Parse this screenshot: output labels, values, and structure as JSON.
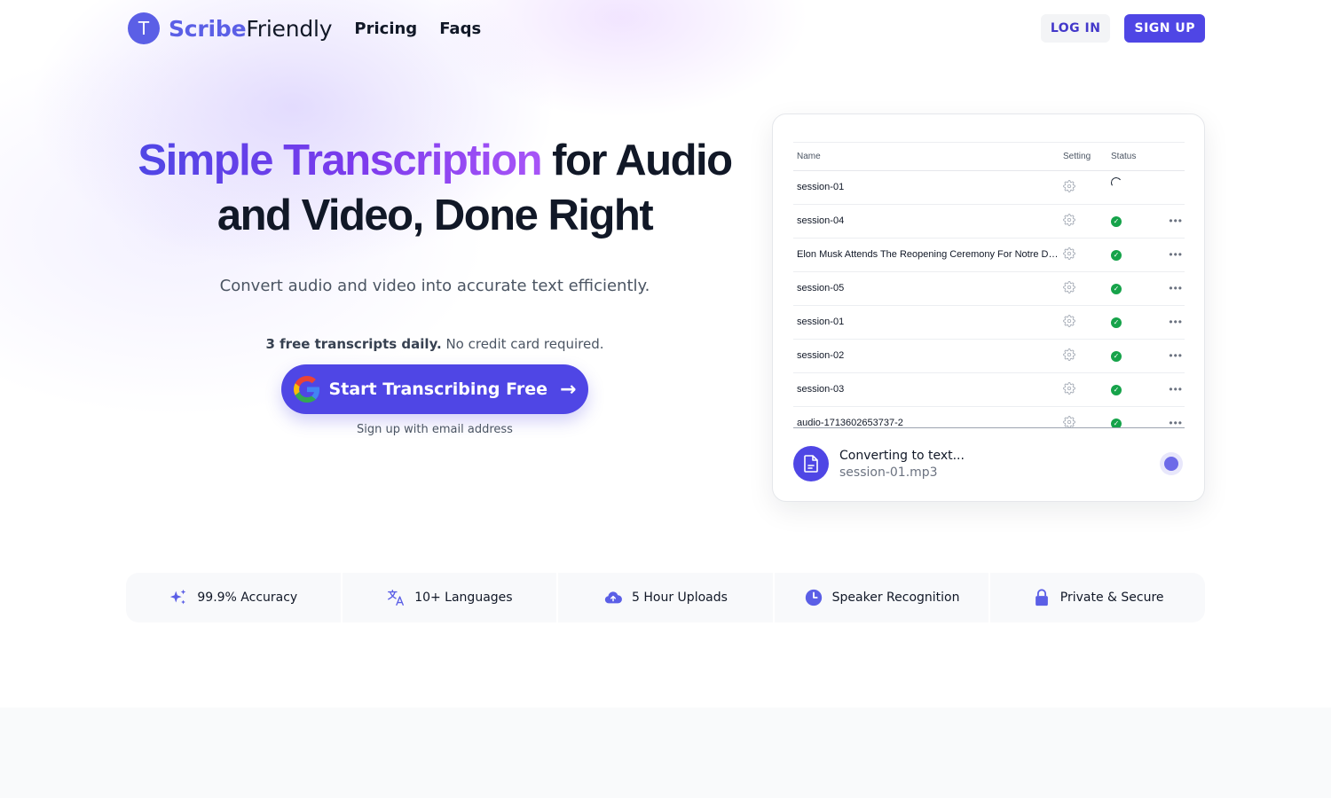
{
  "nav": {
    "logo_letter": "T",
    "brand_part1": "Scribe",
    "brand_part2": "Friendly",
    "links": [
      "Pricing",
      "Faqs"
    ],
    "login_label": "LOG IN",
    "signup_label": "SIGN UP"
  },
  "hero": {
    "title_highlight": "Simple Transcription",
    "title_rest_line1": " for Audio",
    "title_line2": "and Video, Done Right",
    "subtitle": "Convert audio and video into accurate text efficiently.",
    "free_note_bold": "3 free transcripts daily.",
    "free_note_rest": " No credit card required.",
    "cta_label": "Start Transcribing Free",
    "cta_arrow": "→",
    "email_link": "Sign up with email address"
  },
  "card": {
    "columns": [
      "Name",
      "Setting",
      "Status"
    ],
    "rows": [
      {
        "name": "session-01",
        "status": "processing"
      },
      {
        "name": "session-04",
        "status": "done"
      },
      {
        "name": "Elon Musk Attends The Reopening Ceremony For Notre Dame Cathedral",
        "status": "done"
      },
      {
        "name": "session-05",
        "status": "done"
      },
      {
        "name": "session-01",
        "status": "done"
      },
      {
        "name": "session-02",
        "status": "done"
      },
      {
        "name": "session-03",
        "status": "done"
      },
      {
        "name": "audio-1713602653737-2",
        "status": "done"
      }
    ],
    "progress": {
      "title": "Converting to text...",
      "file": "session-01.mp3"
    }
  },
  "features": [
    {
      "icon": "sparkles-icon",
      "label": "99.9% Accuracy"
    },
    {
      "icon": "translate-icon",
      "label": "10+ Languages"
    },
    {
      "icon": "cloud-upload-icon",
      "label": "5 Hour Uploads"
    },
    {
      "icon": "clock-icon",
      "label": "Speaker Recognition"
    },
    {
      "icon": "lock-icon",
      "label": "Private & Secure"
    }
  ],
  "colors": {
    "brand": "#5b5fe6",
    "primary_button": "#4f46e5",
    "success": "#16a34a"
  }
}
